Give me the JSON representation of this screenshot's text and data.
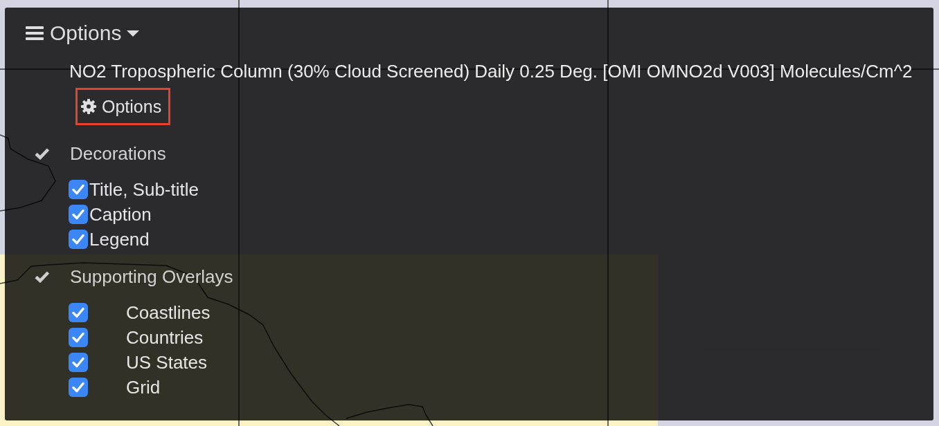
{
  "menu_button": {
    "label": "Options"
  },
  "layer": {
    "title": "NO2 Tropospheric Column (30% Cloud Screened) Daily 0.25 Deg. [OMI OMNO2d V003] Molecules/Cm^2",
    "options_button": {
      "label": "Options",
      "highlighted": true
    }
  },
  "groups": [
    {
      "label": "Decorations",
      "checked": true,
      "kind": "inline",
      "items": [
        {
          "label": "Title, Sub-title",
          "checked": true
        },
        {
          "label": "Caption",
          "checked": true
        },
        {
          "label": "Legend",
          "checked": true
        }
      ]
    },
    {
      "label": "Supporting Overlays",
      "checked": true,
      "kind": "indented",
      "items": [
        {
          "label": "Coastlines",
          "checked": true
        },
        {
          "label": "Countries",
          "checked": true
        },
        {
          "label": "US States",
          "checked": true
        },
        {
          "label": "Grid",
          "checked": true
        }
      ]
    }
  ]
}
